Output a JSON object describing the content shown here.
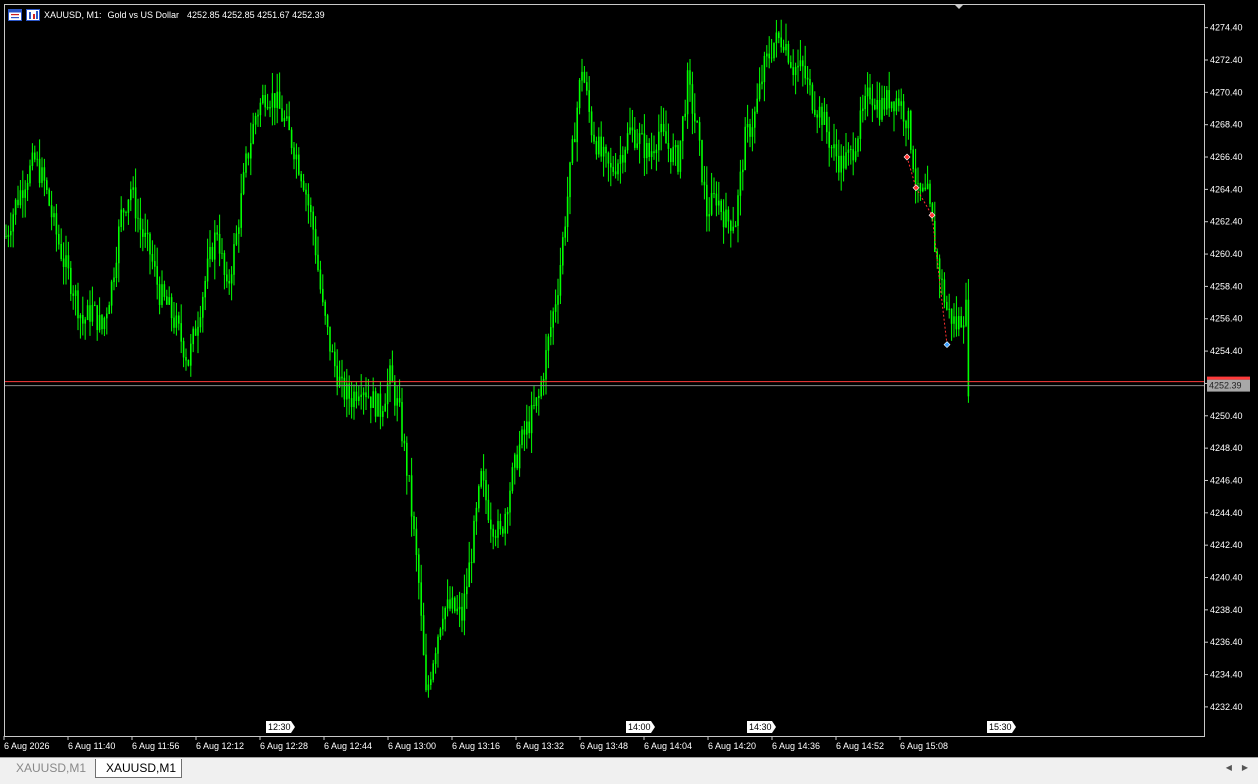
{
  "window": {
    "symbol": "XAUUSD, M1:",
    "description": "Gold vs US Dollar",
    "ohlc": "4252.85 4252.85 4251.67 4252.39"
  },
  "chart_data": {
    "type": "candlestick",
    "symbol": "XAUUSD",
    "timeframe": "M1",
    "ylim": [
      4230.6,
      4275.8
    ],
    "y_ticks": [
      "4274.40",
      "4272.40",
      "4270.40",
      "4268.40",
      "4266.40",
      "4264.40",
      "4262.40",
      "4260.40",
      "4258.40",
      "4256.40",
      "4254.40",
      "4252.40",
      "4250.40",
      "4248.40",
      "4246.40",
      "4244.40",
      "4242.40",
      "4240.40",
      "4238.40",
      "4236.40",
      "4234.40",
      "4232.40"
    ],
    "x_ticks": [
      "6 Aug 2026",
      "6 Aug 11:40",
      "6 Aug 11:56",
      "6 Aug 12:12",
      "6 Aug 12:28",
      "6 Aug 12:44",
      "6 Aug 13:00",
      "6 Aug 13:16",
      "6 Aug 13:32",
      "6 Aug 13:48",
      "6 Aug 14:04",
      "6 Aug 14:20",
      "6 Aug 14:36",
      "6 Aug 14:52",
      "6 Aug 15:08"
    ],
    "session_markers": [
      "12:30",
      "14:00",
      "14:30",
      "15:30"
    ],
    "bid_price": 4252.39,
    "bid_label": "4252.39",
    "price_path": [
      [
        0,
        4261.5
      ],
      [
        4,
        4263.5
      ],
      [
        8,
        4265.0
      ],
      [
        12,
        4266.2
      ],
      [
        16,
        4264.8
      ],
      [
        20,
        4262.2
      ],
      [
        24,
        4260.0
      ],
      [
        28,
        4258.3
      ],
      [
        32,
        4256.2
      ],
      [
        36,
        4257.0
      ],
      [
        40,
        4255.8
      ],
      [
        44,
        4258.5
      ],
      [
        48,
        4262.8
      ],
      [
        52,
        4264.5
      ],
      [
        56,
        4262.0
      ],
      [
        60,
        4260.5
      ],
      [
        64,
        4258.0
      ],
      [
        68,
        4257.0
      ],
      [
        72,
        4255.6
      ],
      [
        76,
        4253.8
      ],
      [
        80,
        4256.5
      ],
      [
        84,
        4259.5
      ],
      [
        88,
        4262.0
      ],
      [
        92,
        4258.0
      ],
      [
        96,
        4261.5
      ],
      [
        100,
        4266.0
      ],
      [
        104,
        4269.0
      ],
      [
        108,
        4270.3
      ],
      [
        112,
        4270.0
      ],
      [
        116,
        4268.6
      ],
      [
        120,
        4267.0
      ],
      [
        124,
        4265.0
      ],
      [
        128,
        4262.0
      ],
      [
        132,
        4257.0
      ],
      [
        136,
        4254.0
      ],
      [
        140,
        4252.0
      ],
      [
        144,
        4251.5
      ],
      [
        148,
        4252.5
      ],
      [
        152,
        4251.5
      ],
      [
        156,
        4250.8
      ],
      [
        160,
        4252.8
      ],
      [
        164,
        4250.5
      ],
      [
        168,
        4246.0
      ],
      [
        172,
        4240.0
      ],
      [
        175,
        4233.0
      ],
      [
        178,
        4235.5
      ],
      [
        182,
        4238.5
      ],
      [
        186,
        4238.5
      ],
      [
        190,
        4238.0
      ],
      [
        194,
        4242.0
      ],
      [
        198,
        4246.5
      ],
      [
        202,
        4244.0
      ],
      [
        206,
        4243.0
      ],
      [
        210,
        4246.0
      ],
      [
        214,
        4248.5
      ],
      [
        218,
        4250.0
      ],
      [
        222,
        4251.5
      ],
      [
        226,
        4255.0
      ],
      [
        230,
        4258.5
      ],
      [
        234,
        4264.0
      ],
      [
        238,
        4269.5
      ],
      [
        240,
        4272.0
      ],
      [
        244,
        4268.2
      ],
      [
        248,
        4266.5
      ],
      [
        252,
        4265.5
      ],
      [
        256,
        4266.5
      ],
      [
        260,
        4268.0
      ],
      [
        264,
        4267.5
      ],
      [
        268,
        4266.5
      ],
      [
        272,
        4268.0
      ],
      [
        276,
        4267.0
      ],
      [
        280,
        4266.2
      ],
      [
        284,
        4271.0
      ],
      [
        288,
        4268.0
      ],
      [
        292,
        4263.0
      ],
      [
        296,
        4264.0
      ],
      [
        300,
        4262.5
      ],
      [
        304,
        4262.5
      ],
      [
        308,
        4267.5
      ],
      [
        312,
        4269.0
      ],
      [
        316,
        4272.0
      ],
      [
        320,
        4273.5
      ],
      [
        324,
        4273.8
      ],
      [
        328,
        4272.0
      ],
      [
        332,
        4271.8
      ],
      [
        336,
        4270.0
      ],
      [
        340,
        4269.0
      ],
      [
        344,
        4267.0
      ],
      [
        348,
        4266.0
      ],
      [
        352,
        4266.5
      ],
      [
        356,
        4268.5
      ],
      [
        360,
        4270.5
      ],
      [
        364,
        4269.5
      ],
      [
        368,
        4270.0
      ],
      [
        372,
        4270.0
      ],
      [
        376,
        4268.5
      ],
      [
        380,
        4264.0
      ],
      [
        384,
        4264.0
      ],
      [
        388,
        4260.0
      ],
      [
        392,
        4257.0
      ],
      [
        396,
        4256.0
      ],
      [
        400,
        4257.0
      ],
      [
        401,
        4252.4
      ]
    ],
    "trade_markers": [
      {
        "kind": "sell",
        "price": 4266.4
      },
      {
        "kind": "sell",
        "price": 4264.5
      },
      {
        "kind": "sell",
        "price": 4262.8
      },
      {
        "kind": "buy",
        "price": 4254.8
      }
    ]
  },
  "tabs": [
    "XAUUSD,M1",
    "XAUUSD,M1"
  ],
  "colors": {
    "background": "#000000",
    "candle": "#00ff00",
    "bid_line": "#ff3b3b",
    "ask_line": "#8a8a8a",
    "axis_text": "#ffffff"
  }
}
